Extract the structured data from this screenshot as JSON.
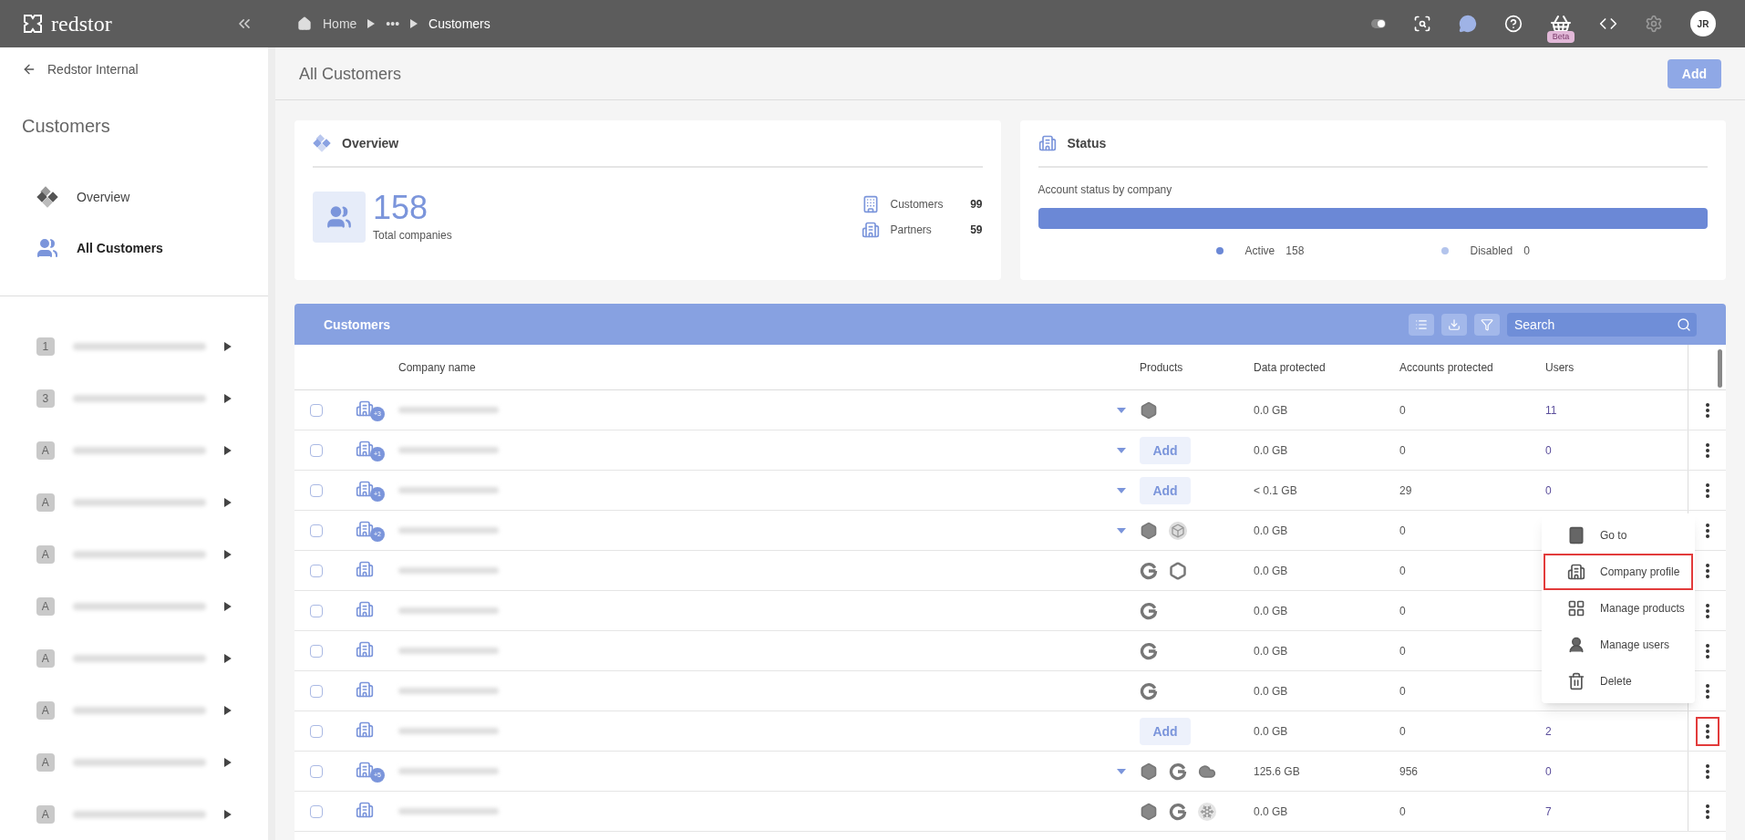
{
  "topbar": {
    "brand": "redstor",
    "breadcrumbs": [
      {
        "label": "Home",
        "kind": "home"
      },
      {
        "label": "•••",
        "kind": "more"
      },
      {
        "label": "Customers",
        "kind": "current"
      }
    ],
    "beta_badge": "Beta",
    "avatar": "JR"
  },
  "sidebar": {
    "back_link": "Redstor Internal",
    "title": "Customers",
    "nav": [
      {
        "label": "Overview",
        "kind": "overview",
        "selected": false
      },
      {
        "label": "All Customers",
        "kind": "customers",
        "selected": true
      }
    ],
    "companies": [
      {
        "initial": "1"
      },
      {
        "initial": "3"
      },
      {
        "initial": "A"
      },
      {
        "initial": "A"
      },
      {
        "initial": "A"
      },
      {
        "initial": "A"
      },
      {
        "initial": "A"
      },
      {
        "initial": "A"
      },
      {
        "initial": "A"
      },
      {
        "initial": "A"
      }
    ]
  },
  "header": {
    "title": "All Customers",
    "add_button": "Add"
  },
  "overview": {
    "title": "Overview",
    "total": "158",
    "total_label": "Total companies",
    "stats": [
      {
        "label": "Customers",
        "value": "99",
        "kind": "single"
      },
      {
        "label": "Partners",
        "value": "59",
        "kind": "multi"
      }
    ]
  },
  "status": {
    "title": "Status",
    "subtitle": "Account status by company",
    "level": 1,
    "legend": [
      {
        "label": "Active",
        "value": "158",
        "color": "#6b88d6"
      },
      {
        "label": "Disabled",
        "value": "0",
        "color": "#b3c4ec"
      }
    ]
  },
  "table": {
    "title": "Customers",
    "search_placeholder": "Search",
    "columns": [
      "Company name",
      "Products",
      "Data protected",
      "Accounts protected",
      "Users"
    ],
    "rows": [
      {
        "checked": false,
        "badge": "+3",
        "expandable": true,
        "products": [
          {
            "kind": "hex"
          }
        ],
        "data": "0.0 GB",
        "accounts": "0",
        "users": "11",
        "menu_open": false
      },
      {
        "checked": false,
        "badge": "+1",
        "expandable": true,
        "products": [],
        "add": "Add",
        "data": "0.0 GB",
        "accounts": "0",
        "users": "0",
        "menu_open": false
      },
      {
        "checked": false,
        "badge": "+1",
        "expandable": true,
        "products": [],
        "add": "Add",
        "data": "< 0.1 GB",
        "accounts": "29",
        "users": "0",
        "menu_open": false
      },
      {
        "checked": false,
        "badge": "+2",
        "expandable": true,
        "products": [
          {
            "kind": "hex"
          },
          {
            "kind": "cube"
          }
        ],
        "data": "0.0 GB",
        "accounts": "0",
        "menu_open": false
      },
      {
        "checked": false,
        "expandable": false,
        "products": [
          {
            "kind": "google"
          },
          {
            "kind": "khex"
          }
        ],
        "data": "0.0 GB",
        "accounts": "0",
        "menu_open": false
      },
      {
        "checked": false,
        "expandable": false,
        "products": [
          {
            "kind": "google"
          }
        ],
        "data": "0.0 GB",
        "accounts": "0",
        "menu_open": false
      },
      {
        "checked": false,
        "expandable": false,
        "products": [
          {
            "kind": "google"
          }
        ],
        "data": "0.0 GB",
        "accounts": "0",
        "menu_open": false
      },
      {
        "checked": false,
        "expandable": false,
        "products": [
          {
            "kind": "google"
          }
        ],
        "data": "0.0 GB",
        "accounts": "0",
        "menu_open": false
      },
      {
        "checked": false,
        "expandable": false,
        "products": [],
        "add": "Add",
        "data": "0.0 GB",
        "accounts": "0",
        "users": "2",
        "menu_open": true
      },
      {
        "checked": false,
        "badge": "+5",
        "expandable": true,
        "products": [
          {
            "kind": "hex"
          },
          {
            "kind": "google"
          },
          {
            "kind": "cloud"
          }
        ],
        "data": "125.6 GB",
        "accounts": "956",
        "users": "0",
        "menu_open": false
      },
      {
        "checked": false,
        "expandable": false,
        "products": [
          {
            "kind": "hex"
          },
          {
            "kind": "google"
          },
          {
            "kind": "snow"
          }
        ],
        "data": "0.0 GB",
        "accounts": "0",
        "users": "7",
        "menu_open": false
      }
    ]
  },
  "row_menu": [
    {
      "label": "Go to",
      "kind": "goto",
      "selected": false
    },
    {
      "label": "Company profile",
      "kind": "profile",
      "selected": true
    },
    {
      "label": "Manage products",
      "kind": "products",
      "selected": false
    },
    {
      "label": "Manage users",
      "kind": "users",
      "selected": false
    },
    {
      "label": "Delete",
      "kind": "delete",
      "selected": false
    }
  ]
}
